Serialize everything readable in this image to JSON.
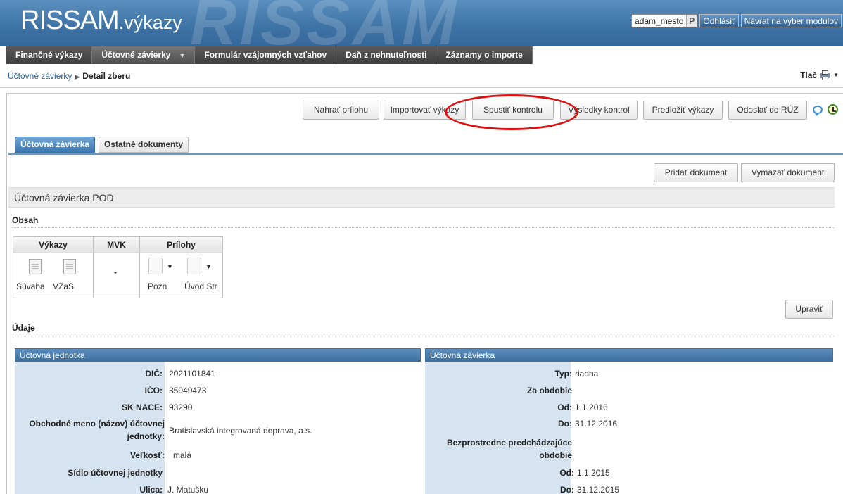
{
  "app": {
    "logo_main": "RISSAM",
    "logo_sub": ".výkazy",
    "watermark": "RISSAM"
  },
  "top": {
    "user": "adam_mesto",
    "user_suffix": "P",
    "logout": "Odhlásiť",
    "back": "Návrat na výber modulov"
  },
  "nav": [
    "Finančné výkazy",
    "Účtovné závierky",
    "Formulár vzájomných vzťahov",
    "Daň z nehnuteľnosti",
    "Záznamy o importe"
  ],
  "breadcrumb": {
    "parent": "Účtovné závierky",
    "current": "Detail zberu"
  },
  "print_label": "Tlač",
  "actions": [
    "Nahrať prílohu",
    "Importovať výkazy",
    "Spustiť kontrolu",
    "Výsledky kontrol",
    "Predložiť výkazy",
    "Odoslať do RÚZ"
  ],
  "tabs": [
    "Účtovná závierka",
    "Ostatné dokumenty"
  ],
  "doc_buttons": {
    "add": "Pridať dokument",
    "delete": "Vymazať dokument"
  },
  "panel_title": "Účtovná závierka POD",
  "section_obsah": "Obsah",
  "doc_table": {
    "headers": [
      "Výkazy",
      "MVK",
      "Prílohy"
    ],
    "vykazy": [
      "Súvaha",
      "VZaS"
    ],
    "mvk": "-",
    "prilohy": [
      "Pozn",
      "Úvod Str"
    ]
  },
  "edit_button": "Upraviť",
  "section_udaje": "Údaje",
  "unit": {
    "title": "Účtovná jednotka",
    "dic_k": "DIČ:",
    "dic_v": "2021101841",
    "ico_k": "IČO:",
    "ico_v": "35949473",
    "nace_k": "SK NACE:",
    "nace_v": "93290",
    "name_k1": "Obchodné meno (názov) účtovnej",
    "name_k2": "jednotky:",
    "name_v": "Bratislavská integrovaná doprava, a.s.",
    "size_k": "Veľkosť:",
    "size_v": "malá",
    "seat_k": "Sídlo účtovnej jednotky",
    "street_k": "Ulica:",
    "street_v": "J. Matušku"
  },
  "closing": {
    "title": "Účtovná závierka",
    "typ_k": "Typ:",
    "typ_v": "riadna",
    "period_k": "Za obdobie",
    "od1_k": "Od:",
    "od1_v": "1.1.2016",
    "do1_k": "Do:",
    "do1_v": "31.12.2016",
    "prev_k1": "Bezprostredne predchádzajúce",
    "prev_k2": "obdobie",
    "od2_k": "Od:",
    "od2_v": "1.1.2015",
    "do2_k": "Do:",
    "do2_v": "31.12.2015"
  }
}
